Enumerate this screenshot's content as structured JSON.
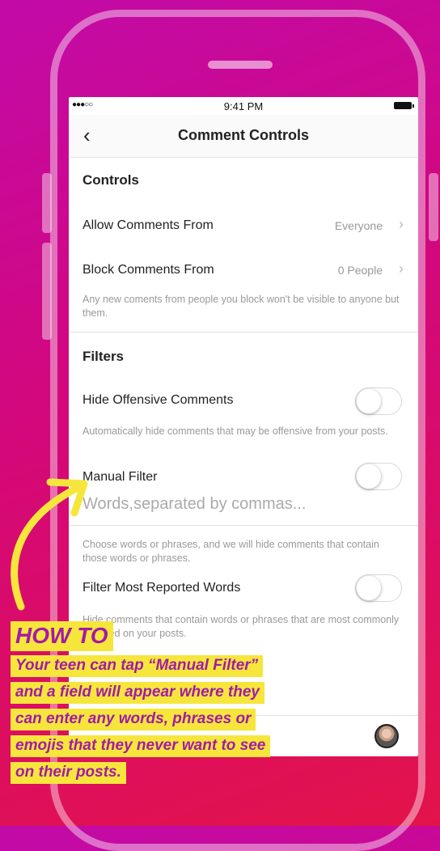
{
  "status_bar": {
    "time": "9:41 PM",
    "signal": "●●●○○"
  },
  "nav": {
    "back_glyph": "‹",
    "title": "Comment Controls"
  },
  "controls": {
    "title": "Controls",
    "allow_label": "Allow Comments From",
    "allow_value": "Everyone",
    "block_label": "Block Comments From",
    "block_value": "0 People",
    "block_note": "Any new coments from people you block won't be visible to anyone but them."
  },
  "filters": {
    "title": "Filters",
    "hide_offensive_label": "Hide Offensive Comments",
    "hide_offensive_on": false,
    "hide_offensive_note": "Automatically hide comments that may be offensive from your posts.",
    "manual_label": "Manual Filter",
    "manual_on": false,
    "words_placeholder": "Words,separated by commas...",
    "manual_note": "Choose words or phrases, and we will hide comments that contain those words or phrases.",
    "most_reported_label": "Filter Most Reported Words",
    "most_reported_on": false,
    "most_reported_note": "Hide comments that contain words or phrases that are most commonly reported on your posts."
  },
  "overlay": {
    "title": "HOW TO",
    "lines": [
      "Your teen can tap “Manual Filter”",
      "and a field will appear where they",
      "can enter any words, phrases or",
      "emojis that they never want to see",
      "on their posts."
    ],
    "highlight_color": "#f6e63c",
    "text_color": "#a31aa7"
  },
  "icons": {
    "chevron": "›",
    "arrow": "curved-arrow-icon",
    "avatar": "profile-avatar"
  }
}
